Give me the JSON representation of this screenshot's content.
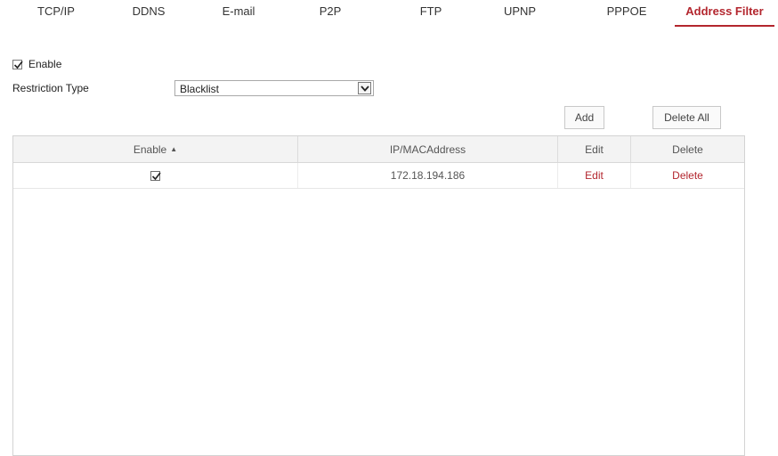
{
  "tabs": [
    {
      "label": "TCP/IP"
    },
    {
      "label": "DDNS"
    },
    {
      "label": "E-mail"
    },
    {
      "label": "P2P"
    },
    {
      "label": "FTP"
    },
    {
      "label": "UPNP"
    },
    {
      "label": "PPPOE"
    },
    {
      "label": "Address Filter",
      "active": true
    }
  ],
  "form": {
    "enable_label": "Enable",
    "enable_checked": true,
    "restriction_label": "Restriction Type",
    "restriction_value": "Blacklist"
  },
  "toolbar": {
    "add_label": "Add",
    "delete_all_label": "Delete All"
  },
  "table": {
    "headers": {
      "enable": "Enable",
      "address": "IP/MACAddress",
      "edit": "Edit",
      "delete": "Delete"
    },
    "sort_indicator": "ascending",
    "rows": [
      {
        "enabled": true,
        "address": "172.18.194.186",
        "edit": "Edit",
        "delete": "Delete"
      }
    ]
  },
  "colors": {
    "accent": "#b3262e",
    "header_bg": "#f3f3f3",
    "border": "#d3d3d3"
  }
}
